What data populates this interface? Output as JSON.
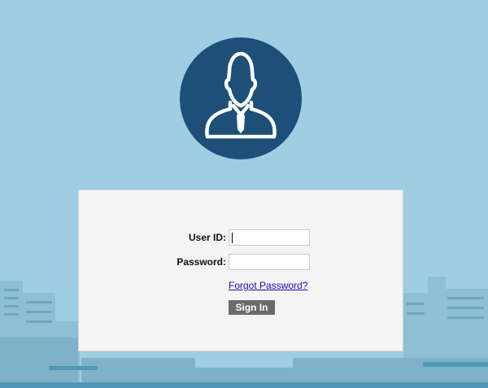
{
  "avatar": {
    "icon": "user-tie-icon"
  },
  "login": {
    "user_id_label": "User ID:",
    "user_id_value": "",
    "password_label": "Password:",
    "password_value": "",
    "forgot_label": "Forgot Password?",
    "signin_label": "Sign In"
  },
  "colors": {
    "background": "#9fcde1",
    "avatar_circle": "#1e4f79",
    "panel": "#f4f4f4",
    "button": "#6b6b6b",
    "link": "#1a0dab"
  }
}
